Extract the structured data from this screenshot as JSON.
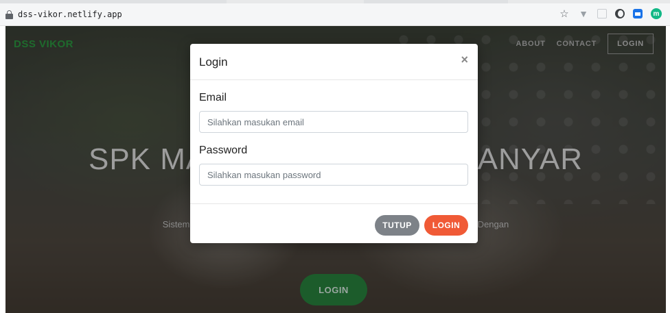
{
  "browser": {
    "url": "dss-vikor.netlify.app",
    "icons": [
      "lock-icon",
      "star-icon",
      "vue-devtools-icon",
      "extension-box-icon",
      "dark-mode-icon",
      "calendar-extension-icon",
      "m-extension-icon"
    ],
    "m_icon_label": "m"
  },
  "navbar": {
    "brand": "DSS VIKOR",
    "links": [
      "ABOUT",
      "CONTACT"
    ],
    "login": "LOGIN",
    "brand_color": "#1e6b2d"
  },
  "hero": {
    "title": "SPK MADRASAH KARANGANYAR",
    "subtitle": "Sistem Pendukung Keputusan Pemilihan Madrasah di Kabupaten Karanganyar Dengan",
    "button": "LOGIN",
    "button_color": "#1c5c2b"
  },
  "modal": {
    "title": "Login",
    "close_symbol": "×",
    "email": {
      "label": "Email",
      "placeholder": "Silahkan masukan email",
      "value": ""
    },
    "password": {
      "label": "Password",
      "placeholder": "Silahkan masukan password",
      "value": ""
    },
    "buttons": {
      "close": "TUTUP",
      "login": "LOGIN"
    },
    "colors": {
      "close": "#7d8288",
      "login": "#f05a36"
    }
  }
}
